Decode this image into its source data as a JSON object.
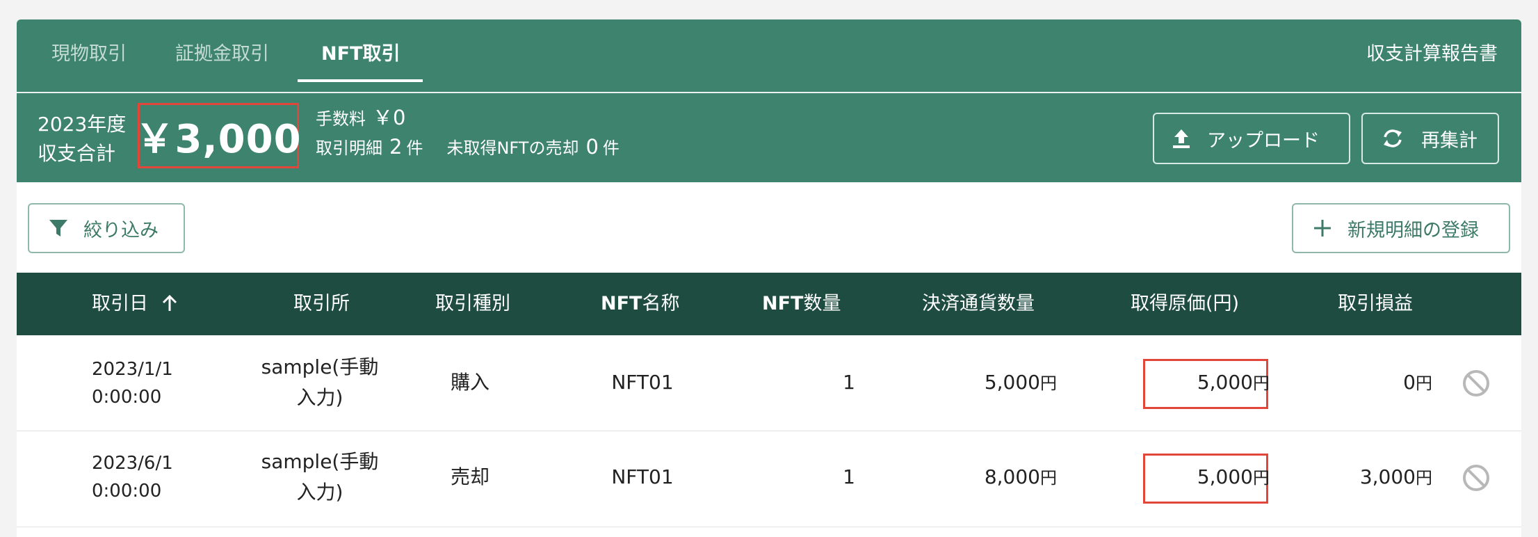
{
  "tabs": [
    {
      "label": "現物取引"
    },
    {
      "label": "証拠金取引"
    },
    {
      "label": "NFT取引"
    }
  ],
  "report_link": "収支計算報告書",
  "summary": {
    "year": "2023年度",
    "total_label": "収支合計",
    "total_value": "￥3,000",
    "fee_label": "手数料",
    "fee_value": "￥0",
    "detail_label": "取引明細",
    "detail_count": "2",
    "detail_unit": "件",
    "unacquired_label": "未取得NFTの売却",
    "unacquired_count": "0",
    "unacquired_unit": "件"
  },
  "buttons": {
    "upload": "アップロード",
    "recalc": "再集計",
    "filter": "絞り込み",
    "new_entry": "新規明細の登録"
  },
  "table": {
    "headers": {
      "date": "取引日",
      "exchange": "取引所",
      "type": "取引種別",
      "nft_name_prefix": "NFT",
      "nft_name_suffix": "名称",
      "nft_qty_prefix": "NFT",
      "nft_qty_suffix": "数量",
      "settlement_qty": "決済通貨数量",
      "acq_cost": "取得原価(円)",
      "pnl": "取引損益"
    },
    "yen_unit": "円",
    "rows": [
      {
        "date_line1": "2023/1/1",
        "date_line2": "0:00:00",
        "exchange_line1": "sample(手動",
        "exchange_line2": "入力)",
        "type": "購入",
        "nft_name": "NFT01",
        "nft_qty": "1",
        "settlement_qty": "5,000",
        "acq_cost": "5,000",
        "pnl": "0"
      },
      {
        "date_line1": "2023/6/1",
        "date_line2": "0:00:00",
        "exchange_line1": "sample(手動",
        "exchange_line2": "入力)",
        "type": "売却",
        "nft_name": "NFT01",
        "nft_qty": "1",
        "settlement_qty": "8,000",
        "acq_cost": "5,000",
        "pnl": "3,000"
      }
    ]
  },
  "colors": {
    "header_green": "#3d836d",
    "table_header": "#1f4c40",
    "highlight_red": "#e2463b",
    "accent_green": "#3d7a67"
  }
}
